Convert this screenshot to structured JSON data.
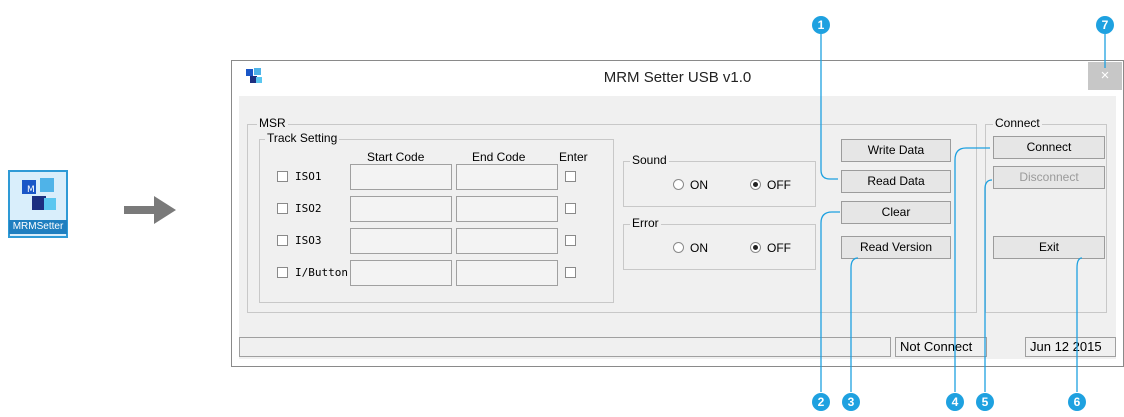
{
  "desktop": {
    "icon_label": "MRMSetter"
  },
  "window": {
    "title": "MRM Setter USB v1.0",
    "close_glyph": "×"
  },
  "msr": {
    "group_label": "MSR",
    "track_setting_label": "Track Setting",
    "headers": {
      "start_code": "Start Code",
      "end_code": "End Code",
      "enter": "Enter"
    },
    "tracks": [
      {
        "label": "ISO1",
        "start": "",
        "end": "",
        "checked": false,
        "enter": false
      },
      {
        "label": "ISO2",
        "start": "",
        "end": "",
        "checked": false,
        "enter": false
      },
      {
        "label": "ISO3",
        "start": "",
        "end": "",
        "checked": false,
        "enter": false
      },
      {
        "label": "I/Button",
        "start": "",
        "end": "",
        "checked": false,
        "enter": false
      }
    ]
  },
  "sound": {
    "label": "Sound",
    "on_label": "ON",
    "off_label": "OFF",
    "selected": "OFF"
  },
  "error": {
    "label": "Error",
    "on_label": "ON",
    "off_label": "OFF",
    "selected": "OFF"
  },
  "buttons": {
    "write_data": "Write Data",
    "read_data": "Read Data",
    "clear": "Clear",
    "read_version": "Read Version"
  },
  "connect": {
    "group_label": "Connect",
    "connect_label": "Connect",
    "disconnect_label": "Disconnect",
    "exit_label": "Exit"
  },
  "statusbar": {
    "left": "",
    "status": "Not Connect",
    "date": "Jun 12 2015"
  },
  "callouts": [
    "1",
    "2",
    "3",
    "4",
    "5",
    "6",
    "7"
  ],
  "colors": {
    "callout": "#1ea1e0",
    "icon_border": "#2e9ad6"
  }
}
